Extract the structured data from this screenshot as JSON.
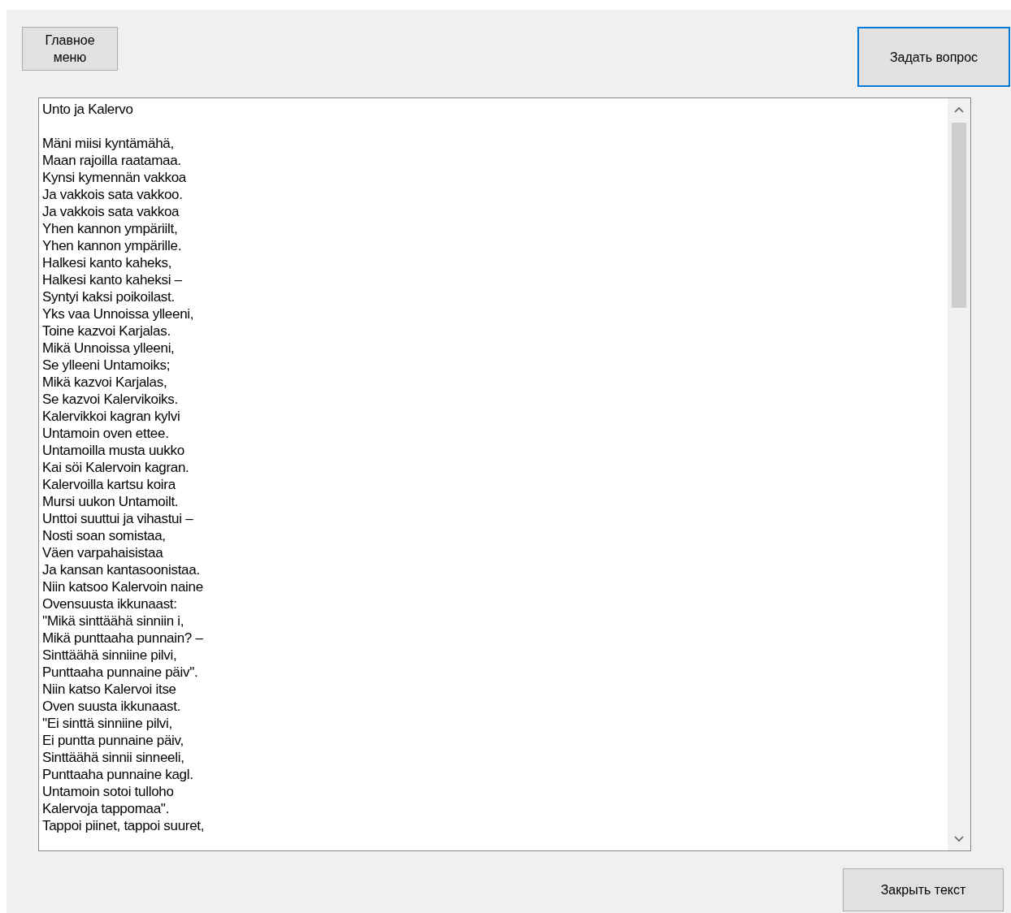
{
  "buttons": {
    "main_menu": {
      "label": "Главное\nменю",
      "focused": false
    },
    "ask_question": {
      "label": "Задать вопрос",
      "focused": true
    },
    "close_text": {
      "label": "Закрыть текст",
      "focused": false
    }
  },
  "text_box": {
    "title": "Unto ja Kalervo",
    "lines": [
      "Mäni miisi kyntämähä,",
      "Maan rajoilla raatamaa.",
      "Kynsi kymennän vakkoa",
      "Ja vakkois sata vakkoo.",
      "Ja vakkois sata vakkoa",
      "Yhen kannon ympäriilt,",
      "Yhen kannon ympärille.",
      "Halkesi kanto kaheks,",
      "Halkesi kanto kaheksi –",
      "Syntyi kaksi poikoilast.",
      "Yks vaa Unnoissa ylleeni,",
      "Toine kazvoi Karjalas.",
      "Mikä Unnoissa ylleeni,",
      "Se ylleeni Untamoiks;",
      "Mikä kazvoi Karjalas,",
      "Se kazvoi Kalervikoiks.",
      "Kalervikkoi kagran kylvi",
      "Untamoin oven ettee.",
      "Untamoilla musta uukko",
      "Kai söi Kalervoin kagran.",
      "Kalervoilla kartsu koira",
      "Mursi uukon Untamoilt.",
      "Unttoi suuttui ja vihastui –",
      "Nosti soan somistaa,",
      "Väen varpahaisistaa",
      "Ja kansan kantasoonistaa.",
      "Niin katsoo Kalervoin naine",
      "Ovensuusta ikkunaast:",
      "''Mikä sinttäähä sinniin i,",
      "Mikä punttaaha punnain? –",
      "Sinttäähä sinniine pilvi,",
      "Punttaaha punnaine päiv''.",
      "Niin katso Kalervoi itse",
      "Oven suusta ikkunaast.",
      "''Ei sinttä sinniine pilvi,",
      "Ei puntta punnaine päiv,",
      "Sinttäähä sinnii sinneeli,",
      "Punttaaha punnaine kagl.",
      "Untamoin sotoi tulloho",
      "Kalervoja tappomaa''.",
      "Tappoi piinet, tappoi suuret,"
    ]
  }
}
